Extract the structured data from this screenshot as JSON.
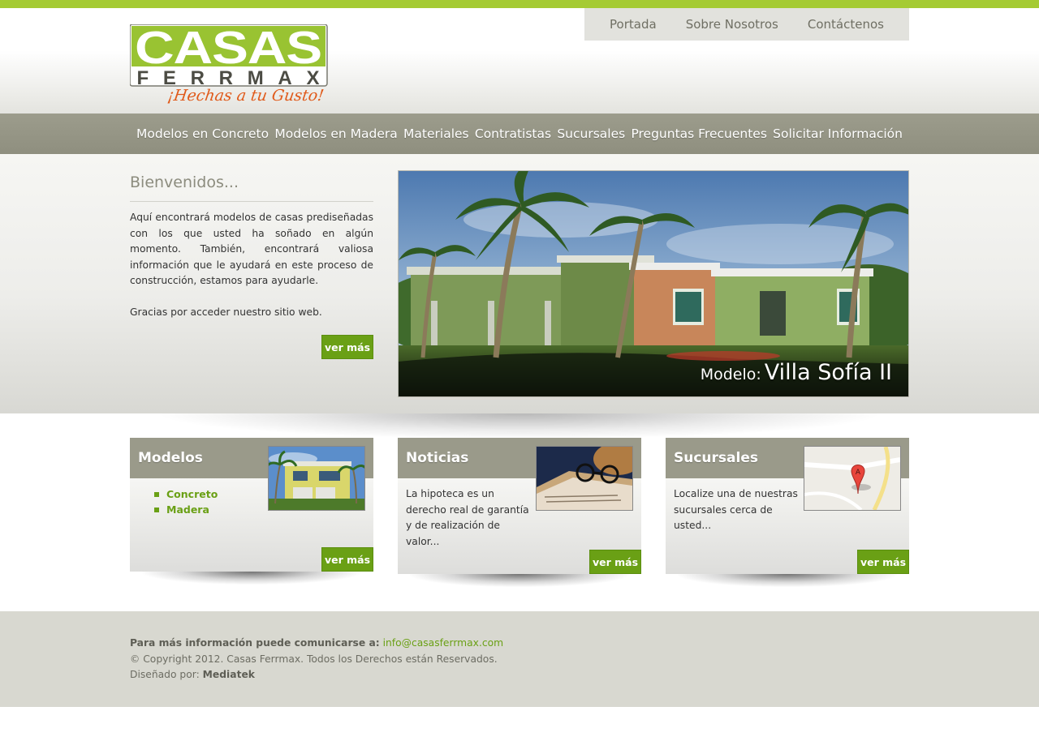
{
  "brand": {
    "logo_top": "CASAS",
    "logo_bottom": "FERRMAX",
    "tagline": "¡Hechas a tu Gusto!",
    "accent_color": "#a5cb33",
    "button_color": "#6aa015"
  },
  "top_nav": [
    "Portada",
    "Sobre Nosotros",
    "Contáctenos"
  ],
  "main_nav": [
    "Modelos en Concreto",
    "Modelos en Madera",
    "Materiales",
    "Contratistas",
    "Sucursales",
    "Preguntas Frecuentes",
    "Solicitar Información"
  ],
  "welcome": {
    "title": "Bienvenidos...",
    "body": "Aquí encontrará modelos de casas prediseñadas con los que usted ha soñado en algún momento. También, encontrará valiosa información que le ayudará en este proceso de construcción, estamos para ayudarle.",
    "thanks": "Gracias por acceder nuestro sitio web.",
    "button": "ver más"
  },
  "slider": {
    "label": "Modelo:",
    "name": "Villa Sofía II"
  },
  "boxes": {
    "modelos": {
      "title": "Modelos",
      "links": [
        "Concreto",
        "Madera"
      ],
      "button": "ver más",
      "thumb_icon": "house-photo"
    },
    "noticias": {
      "title": "Noticias",
      "text": "La hipoteca es un derecho real de garantía y de realización de valor...",
      "button": "ver más",
      "thumb_icon": "newspaper-glasses-photo"
    },
    "sucursales": {
      "title": "Sucursales",
      "text": "Localize una de nuestras sucursales cerca de usted...",
      "button": "ver más",
      "thumb_icon": "map-pin-photo",
      "map_marker": "A"
    }
  },
  "footer": {
    "contact_label": "Para más información puede comunicarse a:",
    "email": "info@casasferrmax.com",
    "copyright": "© Copyright 2012. Casas Ferrmax. Todos los Derechos están Reservados.",
    "designed_label": "Diseñado por:",
    "designer": "Mediatek"
  }
}
